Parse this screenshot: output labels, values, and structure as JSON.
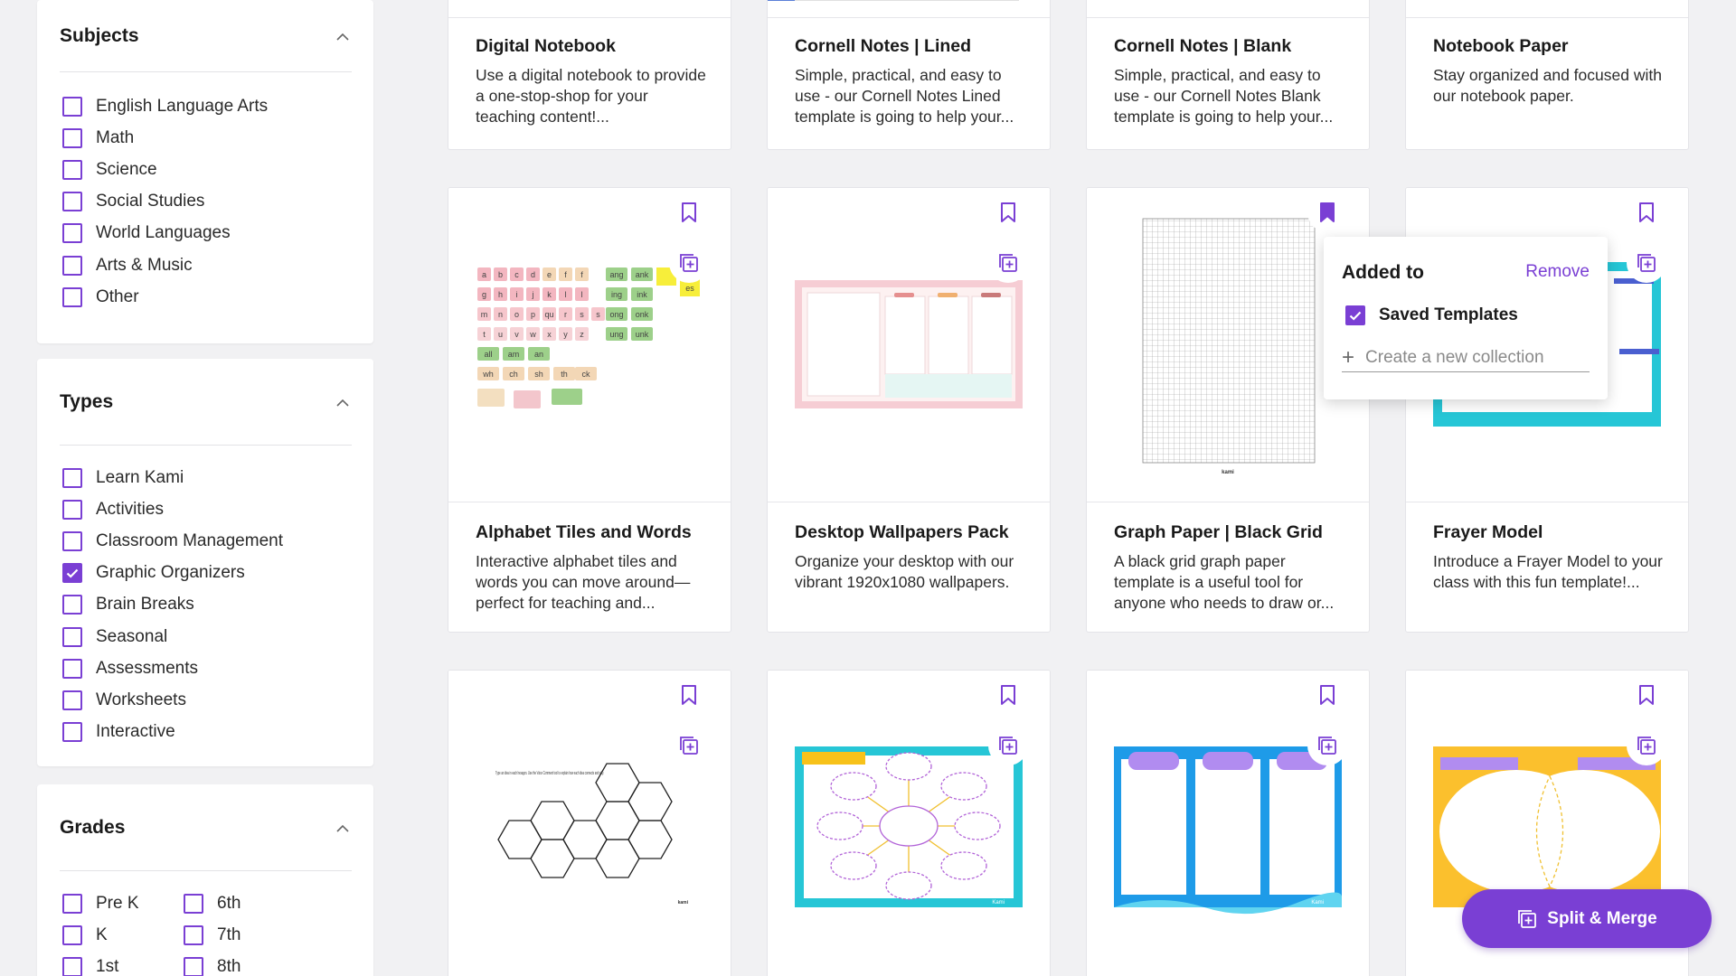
{
  "sidebar": {
    "subjects": {
      "title": "Subjects",
      "items": [
        "English Language Arts",
        "Math",
        "Science",
        "Social Studies",
        "World Languages",
        "Arts & Music",
        "Other"
      ]
    },
    "types": {
      "title": "Types",
      "items": [
        "Learn Kami",
        "Activities",
        "Classroom Management",
        "Graphic Organizers",
        "Brain Breaks",
        "Seasonal",
        "Assessments",
        "Worksheets",
        "Interactive"
      ],
      "checked": "Graphic Organizers"
    },
    "grades": {
      "title": "Grades",
      "left": [
        "Pre K",
        "K",
        "1st"
      ],
      "right": [
        "6th",
        "7th",
        "8th"
      ]
    }
  },
  "cards_row1": [
    {
      "title": "Digital Notebook",
      "desc": "Use a digital notebook to provide a one-stop-shop for your teaching content!..."
    },
    {
      "title": "Cornell Notes | Lined",
      "desc": "Simple, practical, and easy to use - our Cornell Notes Lined template is going to help your..."
    },
    {
      "title": "Cornell Notes | Blank",
      "desc": "Simple, practical, and easy to use - our Cornell Notes Blank template is going to help your..."
    },
    {
      "title": "Notebook Paper",
      "desc": "Stay organized and focused with our notebook paper."
    }
  ],
  "cards_row2": [
    {
      "title": "Alphabet Tiles and Words",
      "desc": "Interactive alphabet tiles and words you can move around—perfect for teaching and..."
    },
    {
      "title": "Desktop Wallpapers Pack",
      "desc": "Organize your desktop with our vibrant 1920x1080 wallpapers."
    },
    {
      "title": "Graph Paper | Black Grid",
      "desc": "A black grid graph paper template is a useful tool for anyone who needs to draw or..."
    },
    {
      "title": "Frayer Model",
      "desc": "Introduce a Frayer Model to your class with this fun template!..."
    }
  ],
  "popup": {
    "title": "Added to",
    "remove": "Remove",
    "saved": "Saved Templates",
    "create": "Create a new collection"
  },
  "thumb_text": {
    "kami": "kami",
    "Kami": "Kami",
    "hex_instructions": "Type an idea in each hexagon. Use the Voice Comment tool to explain how each idea connects and why."
  },
  "fab": {
    "label": "Split & Merge"
  },
  "colors": {
    "accent": "#7a3fd4"
  }
}
